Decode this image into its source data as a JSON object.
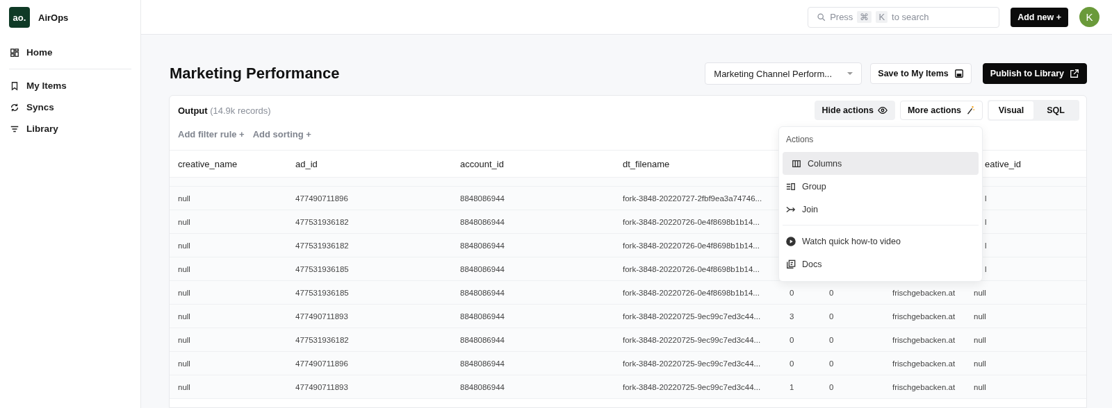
{
  "sidebar": {
    "logo": {
      "mark": "ao.",
      "name": "AirOps"
    },
    "groups": [
      [
        {
          "label": "Home",
          "kind": "grid"
        }
      ],
      [
        {
          "label": "My Items",
          "kind": "bookmark"
        },
        {
          "label": "Syncs",
          "kind": "sync"
        },
        {
          "label": "Library",
          "kind": "filter"
        }
      ]
    ]
  },
  "topbar": {
    "search": {
      "parts": [
        "Press",
        "⌘",
        "K",
        "to search"
      ]
    },
    "add_button": "Add new +",
    "avatar": "K"
  },
  "page": {
    "title": "Marketing Performance",
    "dropdown": "Marketing Channel Perform...",
    "save_button": "Save to My Items",
    "publish_button": "Publish to Library"
  },
  "output": {
    "label": "Output",
    "count": "(14.9k records)",
    "actions": [
      {
        "label": "Hide actions",
        "kind": "eye",
        "selected": true
      },
      {
        "label": "More actions",
        "kind": "wand",
        "selected": false
      }
    ],
    "modes": [
      {
        "label": "Visual",
        "selected": true
      },
      {
        "label": "SQL",
        "selected": false
      }
    ],
    "filters": [
      "Add filter rule +",
      "Add sorting +"
    ]
  },
  "menu": {
    "title": "Actions",
    "groups": [
      [
        {
          "label": "Columns",
          "kind": "columns",
          "selected": true
        },
        {
          "label": "Group",
          "kind": "group",
          "selected": false
        },
        {
          "label": "Join",
          "kind": "join",
          "selected": false
        }
      ],
      [
        {
          "label": "Watch quick how-to video",
          "kind": "play",
          "selected": false
        },
        {
          "label": "Docs",
          "kind": "docs",
          "selected": false
        }
      ]
    ]
  },
  "table": {
    "columns": [
      "creative_name",
      "ad_id",
      "account_id",
      "dt_filename",
      null,
      null,
      null,
      "eative_id"
    ],
    "rows": [
      {
        "cells": [
          "null",
          "477490711896",
          "8848086944",
          "fork-3848-20220727-2fbf9ea3a74746...",
          null,
          null,
          null,
          "l"
        ]
      },
      {
        "cells": [
          "null",
          "477531936182",
          "8848086944",
          "fork-3848-20220726-0e4f8698b1b14...",
          null,
          null,
          null,
          "l"
        ]
      },
      {
        "cells": [
          "null",
          "477531936182",
          "8848086944",
          "fork-3848-20220726-0e4f8698b1b14...",
          null,
          null,
          null,
          "l"
        ]
      },
      {
        "cells": [
          "null",
          "477531936185",
          "8848086944",
          "fork-3848-20220726-0e4f8698b1b14...",
          null,
          null,
          null,
          "l"
        ]
      },
      {
        "cells": [
          "null",
          "477531936185",
          "8848086944",
          "fork-3848-20220726-0e4f8698b1b14...",
          "0",
          "0",
          "frischgebacken.at",
          "null"
        ]
      },
      {
        "cells": [
          "null",
          "477490711893",
          "8848086944",
          "fork-3848-20220725-9ec99c7ed3c44...",
          "3",
          "0",
          "frischgebacken.at",
          "null"
        ]
      },
      {
        "cells": [
          "null",
          "477531936182",
          "8848086944",
          "fork-3848-20220725-9ec99c7ed3c44...",
          "0",
          "0",
          "frischgebacken.at",
          "null"
        ]
      },
      {
        "cells": [
          "null",
          "477490711896",
          "8848086944",
          "fork-3848-20220725-9ec99c7ed3c44...",
          "0",
          "0",
          "frischgebacken.at",
          "null"
        ]
      },
      {
        "cells": [
          "null",
          "477490711893",
          "8848086944",
          "fork-3848-20220725-9ec99c7ed3c44...",
          "1",
          "0",
          "frischgebacken.at",
          "null"
        ]
      }
    ]
  }
}
